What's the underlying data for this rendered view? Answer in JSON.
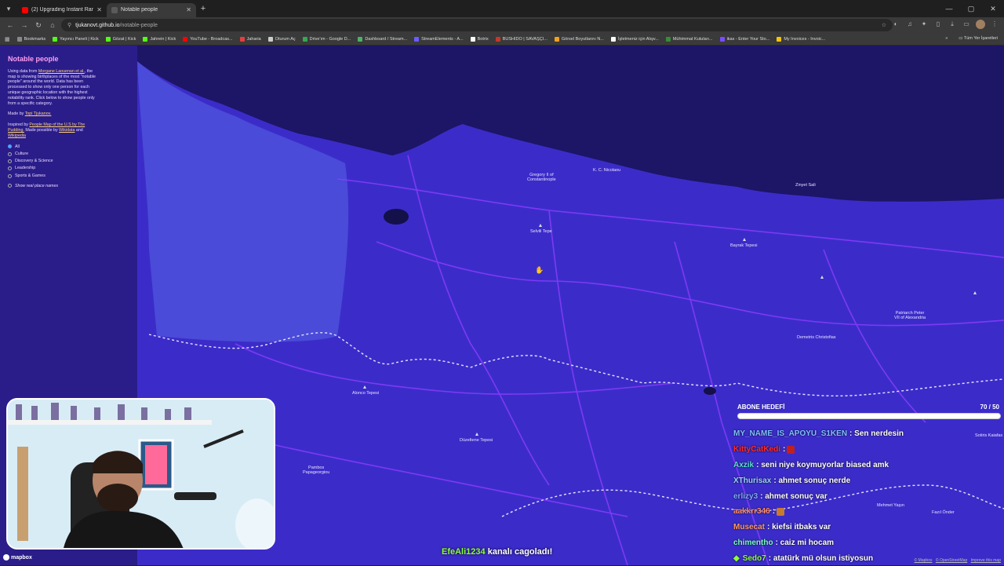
{
  "browser": {
    "tabs": [
      {
        "title": "(2) Upgrading Instant Ramen: T...",
        "favicon_color": "#ff0000",
        "active": false
      },
      {
        "title": "Notable people",
        "favicon_color": "#5a5a5a",
        "active": true
      }
    ],
    "url_host": "tjukanovt.github.io",
    "url_path": "/notable-people",
    "bookmarks": [
      {
        "label": "Bookmarks",
        "color": "#888888"
      },
      {
        "label": "Yayıncı Paneli | Kick",
        "color": "#53fc18"
      },
      {
        "label": "Gözat | Kick",
        "color": "#53fc18"
      },
      {
        "label": "Jahrein | Kick",
        "color": "#53fc18"
      },
      {
        "label": "YouTube - Broadcas...",
        "color": "#ff0000"
      },
      {
        "label": "Jaharia",
        "color": "#e04040"
      },
      {
        "label": "Oturum Aç",
        "color": "#cccccc"
      },
      {
        "label": "Drive'ım - Google D...",
        "color": "#34a853"
      },
      {
        "label": "Dashboard / Stream...",
        "color": "#4fb06a"
      },
      {
        "label": "StreamElements - A...",
        "color": "#6a5cff"
      },
      {
        "label": "Botrix",
        "color": "#ffffff"
      },
      {
        "label": "BUSHIDO | SAVAŞÇI...",
        "color": "#c0392b"
      },
      {
        "label": "Görsel Boyutlarını N...",
        "color": "#f0a020"
      },
      {
        "label": "İşletmeniz için Alışv...",
        "color": "#ffffff"
      },
      {
        "label": "Mühimmat Kutuları...",
        "color": "#3a8a3a"
      },
      {
        "label": "ikas - Enter Your Sto...",
        "color": "#7a4cff"
      },
      {
        "label": "My Invoices - Invoic...",
        "color": "#f4c20d"
      }
    ],
    "bookmarks_right": "Tüm Yer İşaretleri"
  },
  "panel": {
    "title": "Notable people",
    "intro_prefix": "Using data from ",
    "intro_link": "Morgane Laouenan et al.",
    "intro_rest": ", the map is showing birthplaces of the most \"notable people\" around the world. Data has been processed to show only one person for each unique geographic location with the highest notability rank. Click below to show people only from a specific category.",
    "made_by_prefix": "Made by ",
    "made_by_link": "Topi Tjukanov.",
    "inspired_prefix": "Inspired by ",
    "inspired_link1": "People Map of the U.S by The Pudding.",
    "inspired_mid": " Made possible by ",
    "inspired_link2": "Wikidata",
    "inspired_and": " and ",
    "inspired_link3": "Wikipedia",
    "categories": [
      "All",
      "Culture",
      "Discovery & Science",
      "Leadership",
      "Sports & Games"
    ],
    "selected_category": "All",
    "show_real_names": "Show real place names"
  },
  "map_labels": [
    {
      "text": "Gregory II of\nConstantinople"
    },
    {
      "text": "K. C. Nicolaou"
    },
    {
      "text": "Zinyet Sali"
    },
    {
      "text": "Selvili Tepe"
    },
    {
      "text": "Bayrak Tepesi"
    },
    {
      "text": "Patriarch Peter\nVII of Alexandria"
    },
    {
      "text": "Demetris Christofias"
    },
    {
      "text": "Alonco Tepesi"
    },
    {
      "text": "Düzeltene Tepesi"
    },
    {
      "text": "Pambos\nPapageorgiou"
    },
    {
      "text": "Mehmet Yaşın"
    },
    {
      "text": "Fazıl Önder"
    },
    {
      "text": "Sotiris Kaiafas"
    }
  ],
  "goal": {
    "label": "ABONE HEDEFİ",
    "current": 70,
    "target": 50,
    "progress_text": "70 / 50"
  },
  "chat": [
    {
      "user": "MY_NAME_IS_APOYU_S1KEN",
      "color": "#7fbfff",
      "text": ": Sen nerdesin",
      "emote": ""
    },
    {
      "user": "KittyCatKedi",
      "color": "#ff2a2a",
      "text": ":",
      "emote": "#c02020"
    },
    {
      "user": "Axzik",
      "color": "#58e0d0",
      "text": ": seni niye koymuyorlar biased amk",
      "emote": ""
    },
    {
      "user": "XThurisax",
      "color": "#9ad0ff",
      "text": ": ahmet sonuç nerde",
      "emote": ""
    },
    {
      "user": "erlizy3",
      "color": "#7fa8ff",
      "text": ": ahmet sonuç var",
      "emote": ""
    },
    {
      "user": "aakkrr346",
      "color": "#ff8a6a",
      "text": ":",
      "emote": "#c87a30"
    },
    {
      "user": "Musecat",
      "color": "#ff9a6a",
      "text": ": kiefsi itbaks var",
      "emote": ""
    },
    {
      "user": "chimentho",
      "color": "#7affc0",
      "text": ": caiz mi hocam",
      "emote": ""
    },
    {
      "user": "Sedo7",
      "color": "#8cff3a",
      "text": ": atatürk mü olsun istiyosun",
      "emote": ""
    }
  ],
  "follow_banner": {
    "user": "EfeAli1234",
    "text": " kanalı cagoladı!"
  },
  "mapbox_logo": "mapbox",
  "attribution": [
    "© Mapbox",
    "© OpenStreetMap",
    "Improve this map"
  ]
}
